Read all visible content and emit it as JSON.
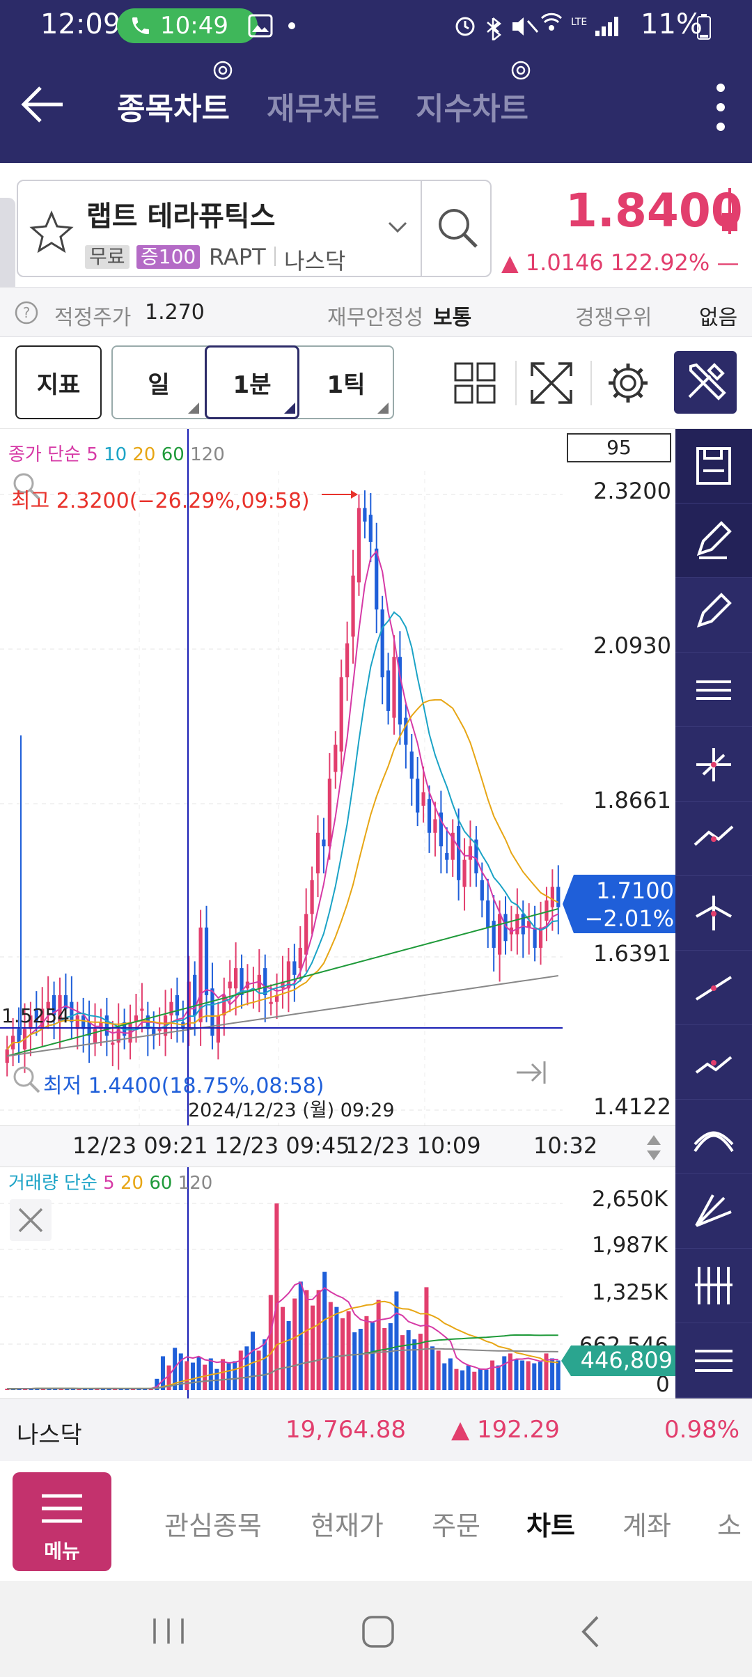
{
  "status_bar": {
    "time": "12:09",
    "call_timer": "10:49",
    "battery": "11%"
  },
  "header": {
    "tabs": [
      "종목차트",
      "재무차트",
      "지수차트"
    ]
  },
  "stock": {
    "name": "랩트 테라퓨틱스",
    "tag_free": "무료",
    "tag_margin": "증100",
    "ticker": "RAPT",
    "market": "나스닥",
    "price": "1.8400",
    "change": "▲ 1.0146  122.92%  —"
  },
  "info": {
    "fair_label": "적정주가",
    "fair_value": "1.270",
    "stability_label": "재무안정성",
    "stability_value": "보통",
    "competitive_label": "경쟁우위",
    "competitive_value": "없음"
  },
  "toolbar": {
    "indicator": "지표",
    "day": "일",
    "minute": "1분",
    "tick": "1틱"
  },
  "chart_data": [
    {
      "type": "candlestick",
      "title": "",
      "legend": [
        "종가 단순",
        "5",
        "10",
        "20",
        "60",
        "120"
      ],
      "count_box": "95",
      "price_ticks": [
        "2.3200",
        "2.0930",
        "1.8661",
        "1.6391",
        "1.4122"
      ],
      "ylim": [
        1.4122,
        2.32
      ],
      "high_label": "최고 2.3200(−26.29%,09:58)",
      "low_label": "최저 1.4400(18.75%,08:58)",
      "crosshair_price": "1.5254",
      "crosshair_time": "2024/12/23 (월) 09:29",
      "current_price": "1.7100",
      "current_change": "−2.01%",
      "x_ticks": [
        "12/23 09:21",
        "12/23 09:45",
        "12/23 10:09",
        "10:32"
      ],
      "close": [
        1.5,
        1.52,
        1.51,
        1.53,
        1.55,
        1.54,
        1.56,
        1.57,
        1.55,
        1.58,
        1.56,
        1.54,
        1.55,
        1.53,
        1.52,
        1.53,
        1.54,
        1.52,
        1.51,
        1.53,
        1.52,
        1.54,
        1.55,
        1.56,
        1.53,
        1.52,
        1.53,
        1.55,
        1.57,
        1.55,
        1.53,
        1.6,
        1.55,
        1.68,
        1.58,
        1.52,
        1.55,
        1.58,
        1.6,
        1.62,
        1.58,
        1.6,
        1.59,
        1.61,
        1.58,
        1.57,
        1.58,
        1.6,
        1.63,
        1.61,
        1.65,
        1.7,
        1.75,
        1.82,
        1.8,
        1.9,
        1.95,
        2.05,
        2.1,
        2.2,
        2.3,
        2.28,
        2.25,
        2.15,
        2.05,
        2.0,
        2.08,
        1.98,
        1.95,
        1.9,
        1.85,
        1.88,
        1.82,
        1.84,
        1.8,
        1.78,
        1.82,
        1.75,
        1.78,
        1.8,
        1.76,
        1.72,
        1.68,
        1.65,
        1.7,
        1.66,
        1.68,
        1.7,
        1.67,
        1.69,
        1.65,
        1.68,
        1.72,
        1.74,
        1.71
      ],
      "ma_colors": [
        "#d63aa6",
        "#1ba3c6",
        "#e7a615",
        "#1f9a3a",
        "#888888"
      ]
    },
    {
      "type": "bar",
      "title": "",
      "legend": [
        "거래량 단순",
        "5",
        "20",
        "60",
        "120"
      ],
      "volume_ticks": [
        "2,650K",
        "1,987K",
        "1,325K",
        "662,546",
        "0"
      ],
      "ylim": [
        0,
        2650000
      ],
      "current_volume": "446,809",
      "values": [
        20,
        15,
        25,
        18,
        22,
        30,
        19,
        25,
        21,
        18,
        24,
        20,
        16,
        22,
        19,
        25,
        20,
        18,
        21,
        17,
        23,
        20,
        22,
        18,
        20,
        160,
        480,
        350,
        600,
        520,
        410,
        390,
        470,
        360,
        450,
        300,
        440,
        380,
        410,
        560,
        620,
        830,
        560,
        720,
        1350,
        2650,
        1180,
        980,
        1300,
        1540,
        1420,
        1200,
        1420,
        1680,
        1250,
        1180,
        1020,
        1120,
        820,
        870,
        1050,
        960,
        1280,
        880,
        950,
        1400,
        780,
        850,
        720,
        800,
        1460,
        620,
        560,
        380,
        450,
        300,
        280,
        350,
        260,
        300,
        290,
        420,
        350,
        480,
        520,
        430,
        420,
        410,
        380,
        400,
        520,
        450,
        420
      ]
    }
  ],
  "right_tools": [
    "save-icon",
    "eraser-icon",
    "eraser-all-icon",
    "hcl-icon",
    "crosshair-icon",
    "trend-icon",
    "cross-tool-icon",
    "line-icon",
    "auto-icon",
    "fan-icon",
    "ray-icon",
    "fibo-icon",
    "bands-icon"
  ],
  "index_bar": {
    "name": "나스닥",
    "value": "19,764.88",
    "change": "▲ 192.29",
    "percent": "0.98%"
  },
  "bottom_nav": {
    "menu": "메뉴",
    "items": [
      "관심종목",
      "현재가",
      "주문",
      "차트",
      "계좌",
      "소"
    ]
  },
  "colors": {
    "header_bg": "#2c2b68",
    "up": "#e23e6d",
    "down": "#1f5fd9",
    "accent": "#c3326d"
  }
}
